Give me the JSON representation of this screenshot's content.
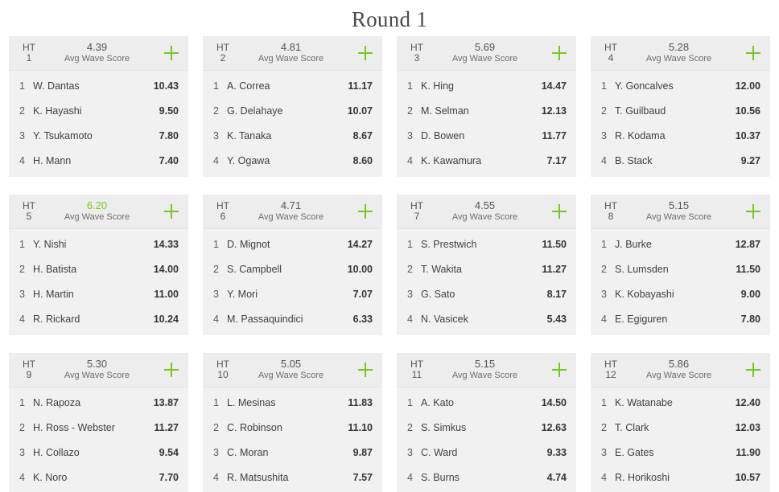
{
  "page": {
    "title": "Round 1",
    "accent_green": "#77c720",
    "card_bg": "#f1f1f1",
    "header_bg": "#ededed"
  },
  "labels": {
    "ht_word": "HT",
    "avg_wave_score": "Avg Wave Score",
    "add_icon": "plus-icon"
  },
  "heats": [
    {
      "ht_word": "HT",
      "number": "1",
      "avg_score": "4.39",
      "avg_label": "Avg Wave Score",
      "highlight": false,
      "athletes": [
        {
          "rank": "1",
          "name": "W. Dantas",
          "score": "10.43"
        },
        {
          "rank": "2",
          "name": "K. Hayashi",
          "score": "9.50"
        },
        {
          "rank": "3",
          "name": "Y. Tsukamoto",
          "score": "7.80"
        },
        {
          "rank": "4",
          "name": "H. Mann",
          "score": "7.40"
        }
      ]
    },
    {
      "ht_word": "HT",
      "number": "2",
      "avg_score": "4.81",
      "avg_label": "Avg Wave Score",
      "highlight": false,
      "athletes": [
        {
          "rank": "1",
          "name": "A. Correa",
          "score": "11.17"
        },
        {
          "rank": "2",
          "name": "G. Delahaye",
          "score": "10.07"
        },
        {
          "rank": "3",
          "name": "K. Tanaka",
          "score": "8.67"
        },
        {
          "rank": "4",
          "name": "Y. Ogawa",
          "score": "8.60"
        }
      ]
    },
    {
      "ht_word": "HT",
      "number": "3",
      "avg_score": "5.69",
      "avg_label": "Avg Wave Score",
      "highlight": false,
      "athletes": [
        {
          "rank": "1",
          "name": "K. Hing",
          "score": "14.47"
        },
        {
          "rank": "2",
          "name": "M. Selman",
          "score": "12.13"
        },
        {
          "rank": "3",
          "name": "D. Bowen",
          "score": "11.77"
        },
        {
          "rank": "4",
          "name": "K. Kawamura",
          "score": "7.17"
        }
      ]
    },
    {
      "ht_word": "HT",
      "number": "4",
      "avg_score": "5.28",
      "avg_label": "Avg Wave Score",
      "highlight": false,
      "athletes": [
        {
          "rank": "1",
          "name": "Y. Goncalves",
          "score": "12.00"
        },
        {
          "rank": "2",
          "name": "T. Guilbaud",
          "score": "10.56"
        },
        {
          "rank": "3",
          "name": "R. Kodama",
          "score": "10.37"
        },
        {
          "rank": "4",
          "name": "B. Stack",
          "score": "9.27"
        }
      ]
    },
    {
      "ht_word": "HT",
      "number": "5",
      "avg_score": "6.20",
      "avg_label": "Avg Wave Score",
      "highlight": true,
      "athletes": [
        {
          "rank": "1",
          "name": "Y. Nishi",
          "score": "14.33"
        },
        {
          "rank": "2",
          "name": "H. Batista",
          "score": "14.00"
        },
        {
          "rank": "3",
          "name": "H. Martin",
          "score": "11.00"
        },
        {
          "rank": "4",
          "name": "R. Rickard",
          "score": "10.24"
        }
      ]
    },
    {
      "ht_word": "HT",
      "number": "6",
      "avg_score": "4.71",
      "avg_label": "Avg Wave Score",
      "highlight": false,
      "athletes": [
        {
          "rank": "1",
          "name": "D. Mignot",
          "score": "14.27"
        },
        {
          "rank": "2",
          "name": "S. Campbell",
          "score": "10.00"
        },
        {
          "rank": "3",
          "name": "Y. Mori",
          "score": "7.07"
        },
        {
          "rank": "4",
          "name": "M. Passaquindici",
          "score": "6.33"
        }
      ]
    },
    {
      "ht_word": "HT",
      "number": "7",
      "avg_score": "4.55",
      "avg_label": "Avg Wave Score",
      "highlight": false,
      "athletes": [
        {
          "rank": "1",
          "name": "S. Prestwich",
          "score": "11.50"
        },
        {
          "rank": "2",
          "name": "T. Wakita",
          "score": "11.27"
        },
        {
          "rank": "3",
          "name": "G. Sato",
          "score": "8.17"
        },
        {
          "rank": "4",
          "name": "N. Vasicek",
          "score": "5.43"
        }
      ]
    },
    {
      "ht_word": "HT",
      "number": "8",
      "avg_score": "5.15",
      "avg_label": "Avg Wave Score",
      "highlight": false,
      "athletes": [
        {
          "rank": "1",
          "name": "J. Burke",
          "score": "12.87"
        },
        {
          "rank": "2",
          "name": "S. Lumsden",
          "score": "11.50"
        },
        {
          "rank": "3",
          "name": "K. Kobayashi",
          "score": "9.00"
        },
        {
          "rank": "4",
          "name": "E. Egiguren",
          "score": "7.80"
        }
      ]
    },
    {
      "ht_word": "HT",
      "number": "9",
      "avg_score": "5.30",
      "avg_label": "Avg Wave Score",
      "highlight": false,
      "athletes": [
        {
          "rank": "1",
          "name": "N. Rapoza",
          "score": "13.87"
        },
        {
          "rank": "2",
          "name": "H. Ross - Webster",
          "score": "11.27"
        },
        {
          "rank": "3",
          "name": "H. Collazo",
          "score": "9.54"
        },
        {
          "rank": "4",
          "name": "K. Noro",
          "score": "7.70"
        }
      ]
    },
    {
      "ht_word": "HT",
      "number": "10",
      "avg_score": "5.05",
      "avg_label": "Avg Wave Score",
      "highlight": false,
      "athletes": [
        {
          "rank": "1",
          "name": "L. Mesinas",
          "score": "11.83"
        },
        {
          "rank": "2",
          "name": "C. Robinson",
          "score": "11.10"
        },
        {
          "rank": "3",
          "name": "C. Moran",
          "score": "9.87"
        },
        {
          "rank": "4",
          "name": "R. Matsushita",
          "score": "7.57"
        }
      ]
    },
    {
      "ht_word": "HT",
      "number": "11",
      "avg_score": "5.15",
      "avg_label": "Avg Wave Score",
      "highlight": false,
      "athletes": [
        {
          "rank": "1",
          "name": "A. Kato",
          "score": "14.50"
        },
        {
          "rank": "2",
          "name": "S. Simkus",
          "score": "12.63"
        },
        {
          "rank": "3",
          "name": "C. Ward",
          "score": "9.33"
        },
        {
          "rank": "4",
          "name": "S. Burns",
          "score": "4.74"
        }
      ]
    },
    {
      "ht_word": "HT",
      "number": "12",
      "avg_score": "5.86",
      "avg_label": "Avg Wave Score",
      "highlight": false,
      "athletes": [
        {
          "rank": "1",
          "name": "K. Watanabe",
          "score": "12.40"
        },
        {
          "rank": "2",
          "name": "T. Clark",
          "score": "12.03"
        },
        {
          "rank": "3",
          "name": "E. Gates",
          "score": "11.90"
        },
        {
          "rank": "4",
          "name": "R. Horikoshi",
          "score": "10.57"
        }
      ]
    }
  ]
}
